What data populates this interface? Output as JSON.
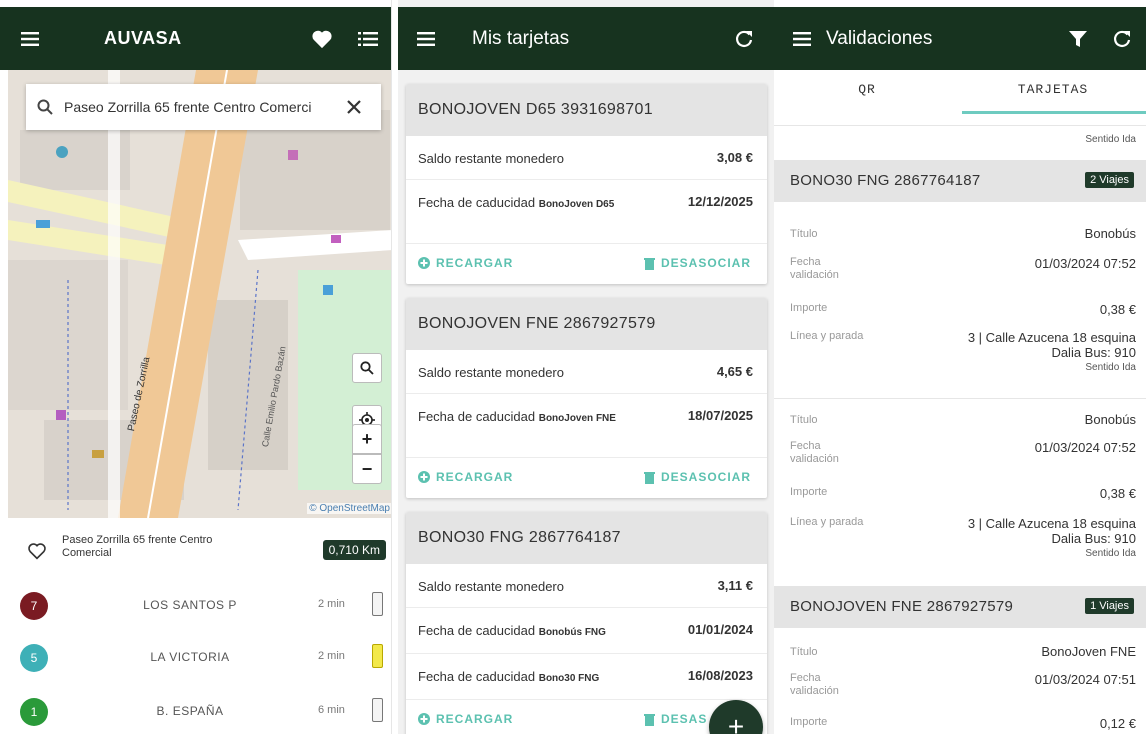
{
  "auvasa": {
    "title": "AUVASA",
    "search_value": "Paseo Zorrilla 65 frente Centro Comerci",
    "map_attribution": "© OpenStreetMap",
    "stop_name": "Paseo Zorrilla 65 frente Centro Comercial",
    "distance": "0,710 Km",
    "street_labels": [
      "Paseo de Zorrilla",
      "Calle Emilio Pardo Bazán"
    ],
    "lines": [
      {
        "number": "7",
        "destination": "LOS SANTOS P",
        "time": "2 min",
        "color": "#7a1b22"
      },
      {
        "number": "5",
        "destination": "LA VICTORIA",
        "time": "2 min",
        "color": "#3eb0b7"
      },
      {
        "number": "1",
        "destination": "B. ESPAÑA",
        "time": "6 min",
        "color": "#2a9a3a"
      }
    ]
  },
  "tarjetas": {
    "title": "Mis tarjetas",
    "cards": [
      {
        "name": "BONOJOVEN D65 3931698701",
        "balance_label": "Saldo restante monedero",
        "balance": "3,08 €",
        "expiries": [
          {
            "label": "Fecha de caducidad",
            "product": "BonoJoven D65",
            "date": "12/12/2025"
          }
        ]
      },
      {
        "name": "BONOJOVEN FNE 2867927579",
        "balance_label": "Saldo restante monedero",
        "balance": "4,65 €",
        "expiries": [
          {
            "label": "Fecha de caducidad",
            "product": "BonoJoven FNE",
            "date": "18/07/2025"
          }
        ]
      },
      {
        "name": "BONO30 FNG 2867764187",
        "balance_label": "Saldo restante monedero",
        "balance": "3,11 €",
        "expiries": [
          {
            "label": "Fecha de caducidad",
            "product": "Bonobús FNG",
            "date": "01/01/2024"
          },
          {
            "label": "Fecha de caducidad",
            "product": "Bono30 FNG",
            "date": "16/08/2023"
          }
        ]
      }
    ],
    "recharge_label": "RECARGAR",
    "unlink_label": "DESASOCIAR",
    "unlink_label_cut": "DESAS",
    "fab": "+"
  },
  "validaciones": {
    "title": "Validaciones",
    "tabs": [
      "QR",
      "TARJETAS"
    ],
    "top_sentido": "Sentido Ida",
    "labels": {
      "titulo": "Título",
      "fecha": "Fecha validación",
      "importe": "Importe",
      "linea": "Línea y parada"
    },
    "groups": [
      {
        "card": "BONO30 FNG 2867764187",
        "badge": "2 Viajes",
        "items": [
          {
            "titulo": "Bonobús",
            "fecha": "01/03/2024 07:52",
            "importe": "0,38 €",
            "linea": "3 | Calle Azucena 18 esquina",
            "linea2": "Dalia Bus: 910",
            "sentido": "Sentido Ida"
          },
          {
            "titulo": "Bonobús",
            "fecha": "01/03/2024 07:52",
            "importe": "0,38 €",
            "linea": "3 | Calle Azucena 18 esquina",
            "linea2": "Dalia Bus: 910",
            "sentido": "Sentido Ida"
          }
        ]
      },
      {
        "card": "BONOJOVEN FNE 2867927579",
        "badge": "1 Viajes",
        "items": [
          {
            "titulo": "BonoJoven FNE",
            "fecha": "01/03/2024 07:51",
            "importe": "0,12 €"
          }
        ]
      }
    ]
  },
  "colors": {
    "appbar": "#17331f",
    "accent": "#5cc1b0",
    "badge": "#1f3a2a"
  },
  "icons": [
    "menu-icon",
    "heart-icon",
    "list-icon",
    "search-icon",
    "close-icon",
    "zoom-search-icon",
    "locate-icon",
    "refresh-icon",
    "filter-icon",
    "trash-icon",
    "plus-circle-icon",
    "battery-icon"
  ]
}
